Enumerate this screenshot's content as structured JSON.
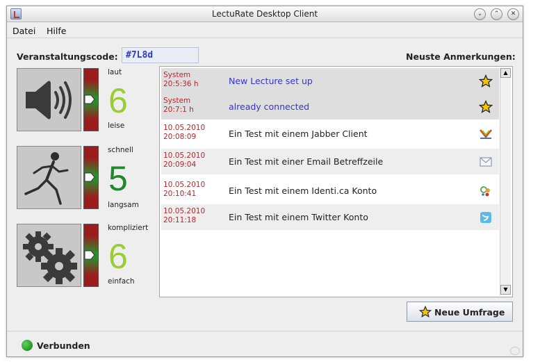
{
  "window": {
    "title": "LectuRate Desktop Client"
  },
  "menu": {
    "items": [
      "Datei",
      "Hilfe"
    ]
  },
  "event_code": {
    "label": "Veranstaltungscode:",
    "value": "#7L8d"
  },
  "notes_label": "Neuste Anmerkungen:",
  "ratings": [
    {
      "top_label": "laut",
      "value": "6",
      "bottom_label": "leise",
      "icon": "speaker-icon",
      "value_color": "#9acd32"
    },
    {
      "top_label": "schnell",
      "value": "5",
      "bottom_label": "langsam",
      "icon": "running-person-icon",
      "value_color": "#1f8a2a"
    },
    {
      "top_label": "kompliziert",
      "value": "6",
      "bottom_label": "einfach",
      "icon": "gears-icon",
      "value_color": "#9acd32"
    }
  ],
  "messages": [
    {
      "sender": "System",
      "time": "20:5:36 h",
      "text": "New Lecture set up",
      "icon": "star-icon",
      "system": true
    },
    {
      "sender": "System",
      "time": "20:7:1 h",
      "text": "already connected",
      "icon": "star-icon",
      "system": true
    },
    {
      "sender": "10.05.2010",
      "time": "20:08:09",
      "text": "Ein Test mit einem Jabber Client",
      "icon": "jabber-icon",
      "system": false
    },
    {
      "sender": "10.05.2010",
      "time": "20:09:04",
      "text": "Ein Test mit einer Email Betreffzeile",
      "icon": "email-icon",
      "system": false
    },
    {
      "sender": "10.05.2010",
      "time": "20:10:41",
      "text": "Ein Test mit einem Identi.ca Konto",
      "icon": "identica-icon",
      "system": false
    },
    {
      "sender": "10.05.2010",
      "time": "20:11:18",
      "text": "Ein Test mit einem Twitter Konto",
      "icon": "twitter-icon",
      "system": false
    }
  ],
  "poll_button": {
    "label": "Neue Umfrage"
  },
  "status": {
    "text": "Verbunden"
  },
  "colors": {
    "system_text": "#3535c8",
    "timestamp": "#b5262b",
    "system_row_bg": "#dedede",
    "alt_row_bg": "#eeeeee",
    "connected": "#1a8f1a"
  }
}
